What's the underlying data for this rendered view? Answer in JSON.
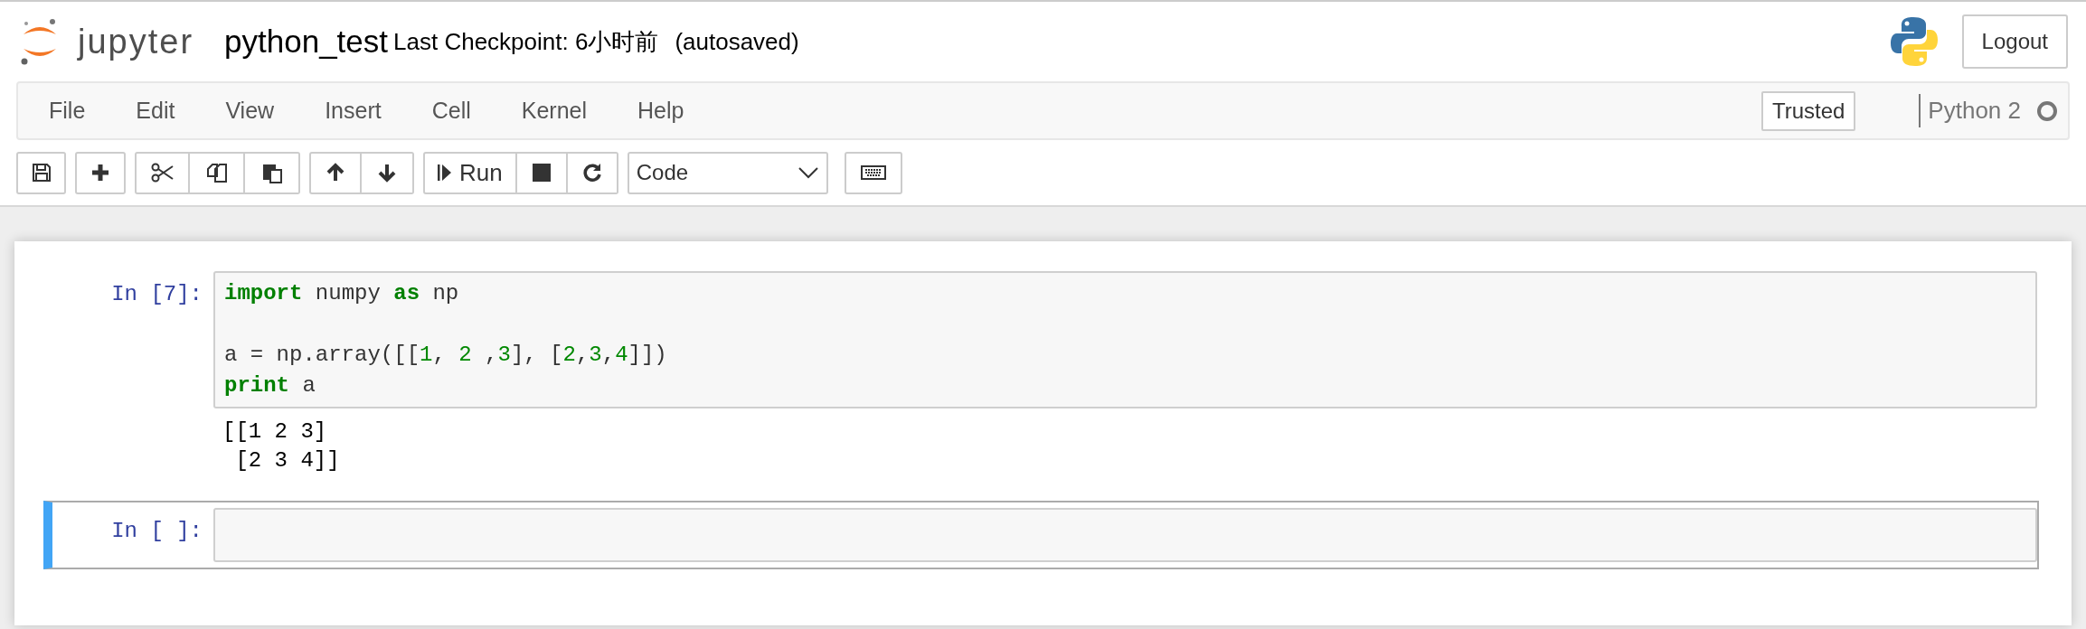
{
  "header": {
    "logo_text": "jupyter",
    "notebook_name": "python_test",
    "checkpoint": "Last Checkpoint: 6小时前",
    "autosave": "(autosaved)",
    "logout": "Logout"
  },
  "menu": [
    "File",
    "Edit",
    "View",
    "Insert",
    "Cell",
    "Kernel",
    "Help"
  ],
  "trusted": "Trusted",
  "kernel": {
    "name": "Python 2",
    "busy": false
  },
  "toolbar": {
    "run_label": "Run",
    "cell_type": "Code"
  },
  "cells": [
    {
      "prompt": "In [7]:",
      "selected": false,
      "code": [
        {
          "kind": "code",
          "tokens": [
            {
              "kind": "keyword",
              "text": "import"
            },
            {
              "kind": "plain",
              "text": " numpy "
            },
            {
              "kind": "keyword",
              "text": "as"
            },
            {
              "kind": "plain",
              "text": " np"
            }
          ]
        },
        {
          "kind": "blank"
        },
        {
          "kind": "code",
          "tokens": [
            {
              "kind": "plain",
              "text": "a = np.array([["
            },
            {
              "kind": "number",
              "text": "1"
            },
            {
              "kind": "plain",
              "text": ", "
            },
            {
              "kind": "number",
              "text": "2"
            },
            {
              "kind": "plain",
              "text": " ,"
            },
            {
              "kind": "number",
              "text": "3"
            },
            {
              "kind": "plain",
              "text": "], ["
            },
            {
              "kind": "number",
              "text": "2"
            },
            {
              "kind": "plain",
              "text": ","
            },
            {
              "kind": "number",
              "text": "3"
            },
            {
              "kind": "plain",
              "text": ","
            },
            {
              "kind": "number",
              "text": "4"
            },
            {
              "kind": "plain",
              "text": "]])"
            }
          ]
        },
        {
          "kind": "code",
          "tokens": [
            {
              "kind": "keyword",
              "text": "print"
            },
            {
              "kind": "plain",
              "text": " a"
            }
          ]
        }
      ],
      "output": [
        "[[1 2 3]",
        " [2 3 4]]"
      ]
    },
    {
      "prompt": "In [ ]:",
      "selected": true
    }
  ]
}
